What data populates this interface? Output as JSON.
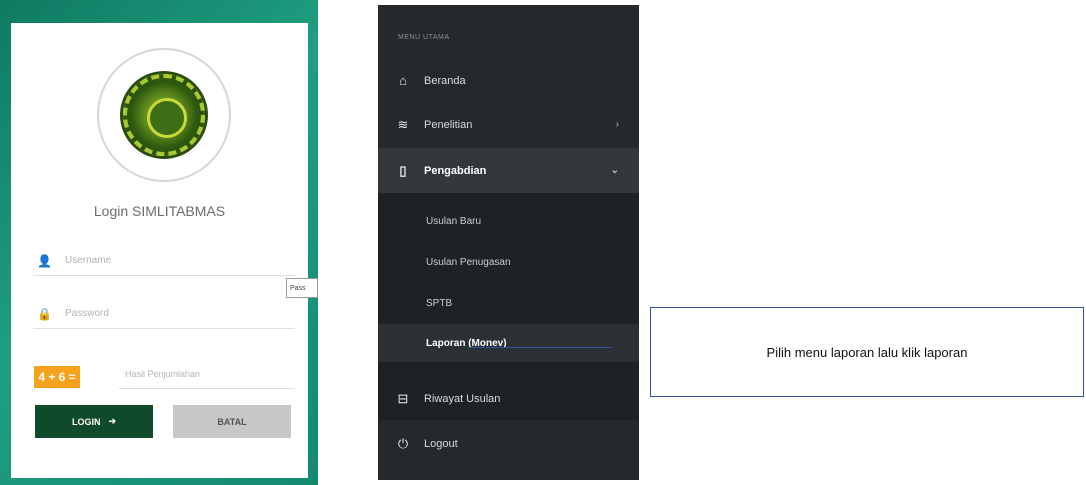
{
  "login": {
    "title": "Login SIMLITABMAS",
    "username_placeholder": "Username",
    "password_placeholder": "Password",
    "captcha_text": "4 + 6 =",
    "captcha_placeholder": "Hasil Penjumlahan",
    "login_label": "LOGIN",
    "login_arrow": "➜",
    "cancel_label": "BATAL",
    "tooltip_text": "Pass",
    "icons": {
      "username": "user-icon",
      "password": "lock-icon"
    },
    "colors": {
      "frame": "#138a70",
      "login_button": "#0f4a2b",
      "captcha": "#f7a21b",
      "cancel_button": "#c7c7c7"
    }
  },
  "sidebar": {
    "header": "MENU UTAMA",
    "items": [
      {
        "label": "Beranda",
        "icon": "home-icon",
        "glyph": "⌂"
      },
      {
        "label": "Penelitian",
        "icon": "layers-icon",
        "glyph": "≋",
        "chevron": "›"
      },
      {
        "label": "Pengabdian",
        "icon": "clipboard-icon",
        "glyph": "▯",
        "chevron": "⌄"
      },
      {
        "label": "Riwayat Usulan",
        "icon": "desktop-icon",
        "glyph": "⊟"
      },
      {
        "label": "Logout",
        "icon": "power-icon",
        "glyph": "⏻"
      }
    ],
    "submenu": [
      {
        "label": "Usulan Baru"
      },
      {
        "label": "Usulan Penugasan"
      },
      {
        "label": "SPTB"
      },
      {
        "label": "Laporan (Monev)"
      }
    ],
    "colors": {
      "background": "#26292c",
      "active": "#33383c",
      "submenu": "#1f2225"
    }
  },
  "annotation": {
    "text": "Pilih menu laporan lalu klik laporan",
    "color": "#2f5496"
  }
}
